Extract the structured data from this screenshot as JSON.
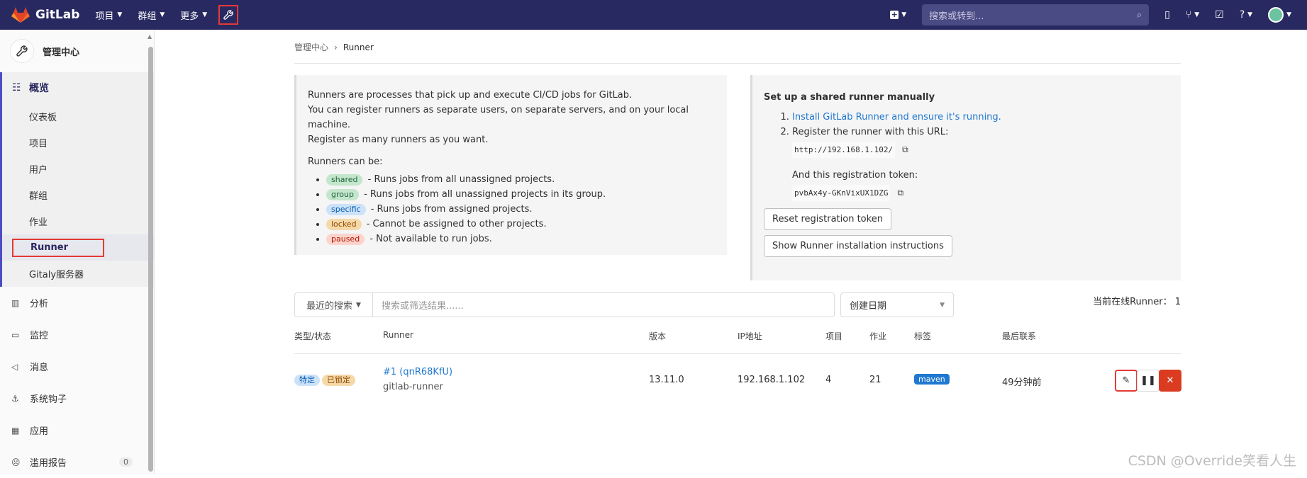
{
  "nav": {
    "brand": "GitLab",
    "projects": "项目",
    "groups": "群组",
    "more": "更多",
    "search_placeholder": "搜索或转到..."
  },
  "sidebar": {
    "header": "管理中心",
    "overview": "概览",
    "sub_items": [
      "仪表板",
      "项目",
      "用户",
      "群组",
      "作业",
      "Runner",
      "Gitaly服务器"
    ],
    "items": [
      {
        "label": "分析",
        "icon": "chart-icon"
      },
      {
        "label": "监控",
        "icon": "monitor-icon"
      },
      {
        "label": "消息",
        "icon": "megaphone-icon"
      },
      {
        "label": "系统钩子",
        "icon": "hook-icon"
      },
      {
        "label": "应用",
        "icon": "apps-icon"
      },
      {
        "label": "滥用报告",
        "icon": "report-icon",
        "badge": "0"
      }
    ]
  },
  "breadcrumb": {
    "root": "管理中心",
    "current": "Runner"
  },
  "info": {
    "line1": "Runners are processes that pick up and execute CI/CD jobs for GitLab.",
    "line2": "You can register runners as separate users, on separate servers, and on your local machine.",
    "line3": "Register as many runners as you want.",
    "can_be": "Runners can be:",
    "types": [
      {
        "label": "shared",
        "text": "- Runs jobs from all unassigned projects."
      },
      {
        "label": "group",
        "text": "- Runs jobs from all unassigned projects in its group."
      },
      {
        "label": "specific",
        "text": "- Runs jobs from assigned projects."
      },
      {
        "label": "locked",
        "text": "- Cannot be assigned to other projects."
      },
      {
        "label": "paused",
        "text": "- Not available to run jobs."
      }
    ]
  },
  "setup": {
    "title": "Set up a shared runner manually",
    "step1": "Install GitLab Runner and ensure it's running.",
    "step2": "Register the runner with this URL:",
    "url": "http://192.168.1.102/",
    "token_label": "And this registration token:",
    "token": "pvbAx4y-GKnVixUX1DZG",
    "reset_button": "Reset registration token",
    "show_button": "Show Runner installation instructions"
  },
  "filter": {
    "recent": "最近的搜索",
    "placeholder": "搜索或筛选结果......",
    "sort": "创建日期",
    "online": "当前在线Runner：  1"
  },
  "table": {
    "headers": [
      "类型/状态",
      "Runner",
      "版本",
      "IP地址",
      "项目",
      "作业",
      "标签",
      "最后联系"
    ],
    "rows": [
      {
        "badges": [
          "特定",
          "已锁定"
        ],
        "runner_id": "#1 (qnR68KfU)",
        "description": "gitlab-runner",
        "version": "13.11.0",
        "ip": "192.168.1.102",
        "projects": "4",
        "jobs": "21",
        "tag": "maven",
        "last_contact": "49分钟前"
      }
    ]
  },
  "watermark": "CSDN @Override笑看人生"
}
